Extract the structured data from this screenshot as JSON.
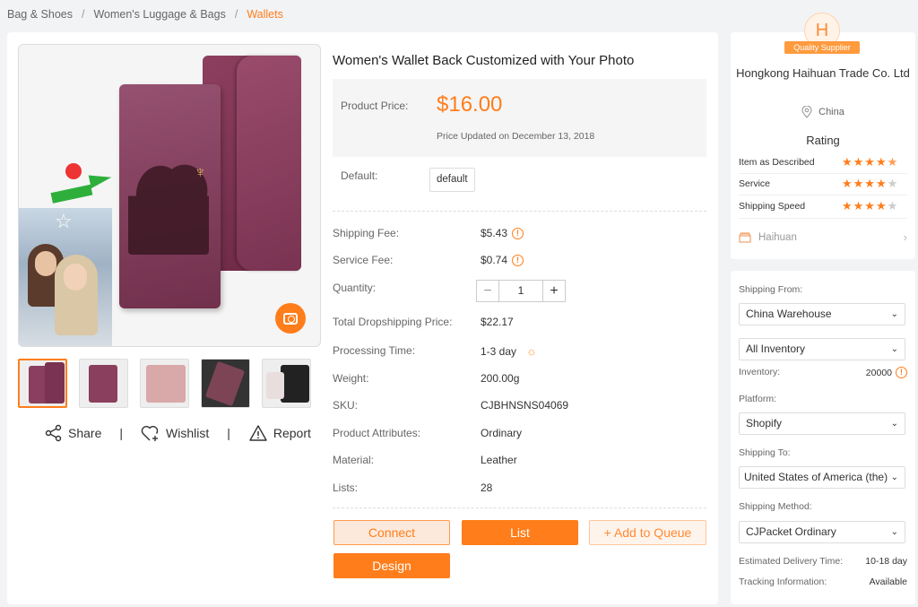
{
  "breadcrumb": {
    "items": [
      "Bag & Shoes",
      "Women's Luggage & Bags"
    ],
    "current": "Wallets",
    "separator": "/"
  },
  "product": {
    "title": "Women's Wallet Back Customized with Your Photo",
    "price_label": "Product Price:",
    "price": "$16.00",
    "price_updated": "Price Updated on December 13, 2018",
    "variant_label": "Default:",
    "variant_value": "default"
  },
  "specs": {
    "shipping_fee_label": "Shipping Fee:",
    "shipping_fee": "$5.43",
    "service_fee_label": "Service Fee:",
    "service_fee": "$0.74",
    "quantity_label": "Quantity:",
    "quantity": "1",
    "total_label": "Total Dropshipping Price:",
    "total": "$22.17",
    "processing_label": "Processing Time:",
    "processing": "1-3 day",
    "weight_label": "Weight:",
    "weight": "200.00g",
    "sku_label": "SKU:",
    "sku": "CJBHNSNS04069",
    "attributes_label": "Product Attributes:",
    "attributes": "Ordinary",
    "material_label": "Material:",
    "material": "Leather",
    "lists_label": "Lists:",
    "lists": "28"
  },
  "buttons": {
    "connect": "Connect",
    "list": "List",
    "add_queue": "+ Add to Queue",
    "design": "Design"
  },
  "gallery_actions": {
    "share": "Share",
    "wishlist": "Wishlist",
    "report": "Report",
    "separator": "|"
  },
  "supplier": {
    "badge_letter": "H",
    "badge_text": "Quality Supplier",
    "name": "Hongkong Haihuan Trade Co. Ltd",
    "location": "China",
    "rating_title": "Rating",
    "ratings": [
      {
        "label": "Item as Described",
        "stars": 4.5
      },
      {
        "label": "Service",
        "stars": 4
      },
      {
        "label": "Shipping Speed",
        "stars": 4
      }
    ],
    "store": "Haihuan"
  },
  "shipping": {
    "from_label": "Shipping From:",
    "from": "China Warehouse",
    "inventory_filter": "All Inventory",
    "inventory_label": "Inventory:",
    "inventory": "20000",
    "platform_label": "Platform:",
    "platform": "Shopify",
    "to_label": "Shipping To:",
    "to": "United States of America (the)",
    "method_label": "Shipping Method:",
    "method": "CJPacket Ordinary",
    "delivery_label": "Estimated Delivery Time:",
    "delivery": "10-18 day",
    "tracking_label": "Tracking Information:",
    "tracking": "Available"
  },
  "colors": {
    "accent": "#ff7d1a",
    "accent_light": "#fde9db"
  }
}
